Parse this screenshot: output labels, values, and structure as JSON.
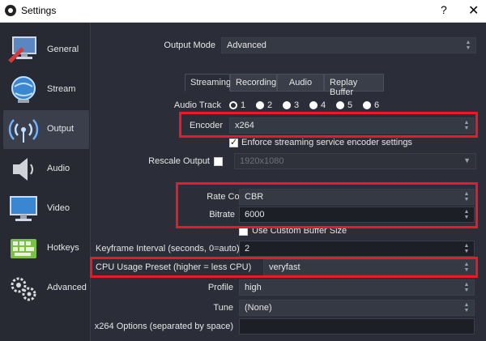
{
  "window": {
    "title": "Settings",
    "help": "?",
    "close": "✕"
  },
  "sidebar": {
    "items": [
      {
        "label": "General"
      },
      {
        "label": "Stream"
      },
      {
        "label": "Output"
      },
      {
        "label": "Audio"
      },
      {
        "label": "Video"
      },
      {
        "label": "Hotkeys"
      },
      {
        "label": "Advanced"
      }
    ],
    "active": "Output"
  },
  "output_mode": {
    "label": "Output Mode",
    "value": "Advanced"
  },
  "tabs": [
    "Streaming",
    "Recording",
    "Audio",
    "Replay Buffer"
  ],
  "audio_track": {
    "label": "Audio Track",
    "options": [
      "1",
      "2",
      "3",
      "4",
      "5",
      "6"
    ],
    "selected": "1"
  },
  "encoder": {
    "label": "Encoder",
    "value": "x264"
  },
  "enforce": {
    "label": "Enforce streaming service encoder settings",
    "checked": true
  },
  "rescale": {
    "label": "Rescale Output",
    "value": "1920x1080",
    "checked": false
  },
  "rate_control": {
    "label": "Rate Control",
    "value": "CBR"
  },
  "bitrate": {
    "label": "Bitrate",
    "value": "6000"
  },
  "custom_buffer": {
    "label": "Use Custom Buffer Size",
    "checked": false
  },
  "keyframe": {
    "label": "Keyframe Interval (seconds, 0=auto)",
    "value": "2"
  },
  "cpu_preset": {
    "label": "CPU Usage Preset (higher = less CPU)",
    "value": "veryfast"
  },
  "profile": {
    "label": "Profile",
    "value": "high"
  },
  "tune": {
    "label": "Tune",
    "value": "(None)"
  },
  "x264_options": {
    "label": "x264 Options (separated by space)",
    "value": ""
  },
  "colors": {
    "highlight": "#e8192c",
    "bg": "#2b2e38"
  }
}
